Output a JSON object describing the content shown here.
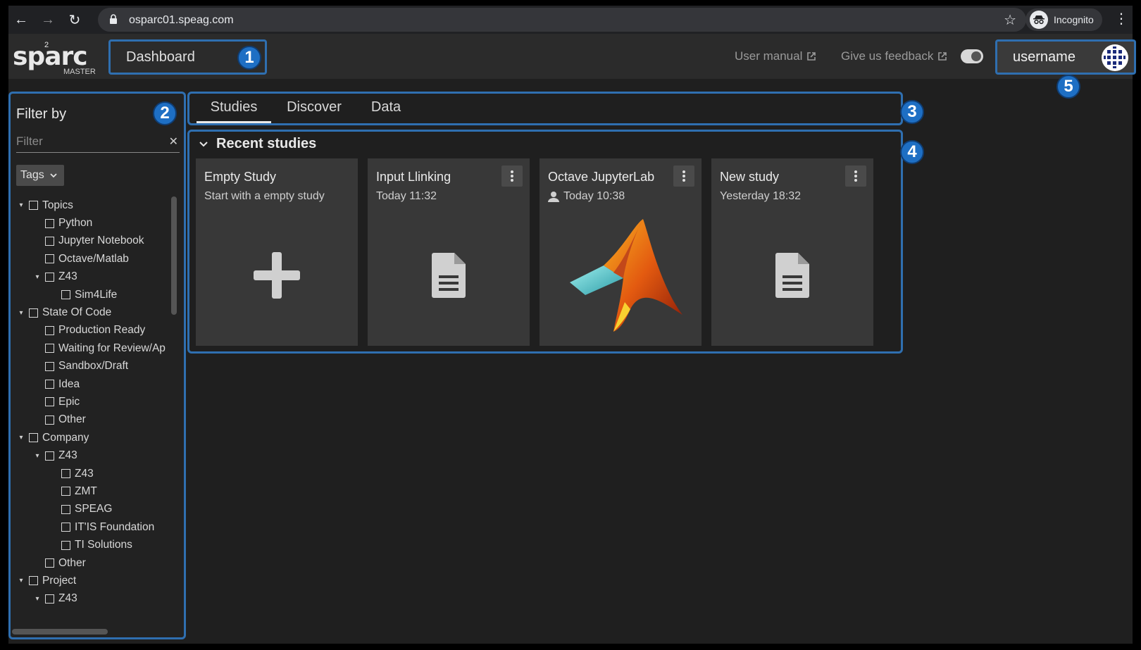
{
  "browser": {
    "url": "osparc01.speag.com",
    "profile_label": "Incognito"
  },
  "header": {
    "logo_text": "sparc",
    "logo_superscript": "2",
    "logo_subtitle": "MASTER",
    "dashboard_label": "Dashboard",
    "user_manual_label": "User manual",
    "feedback_label": "Give us feedback",
    "username": "username"
  },
  "badges": [
    "1",
    "2",
    "3",
    "4",
    "5"
  ],
  "filter": {
    "title": "Filter by",
    "placeholder": "Filter",
    "tags_label": "Tags",
    "tree": [
      {
        "label": "Topics",
        "level": 0,
        "expandable": true
      },
      {
        "label": "Python",
        "level": 1,
        "expandable": false
      },
      {
        "label": "Jupyter Notebook",
        "level": 1,
        "expandable": false
      },
      {
        "label": "Octave/Matlab",
        "level": 1,
        "expandable": false
      },
      {
        "label": "Z43",
        "level": 1,
        "expandable": true
      },
      {
        "label": "Sim4Life",
        "level": 2,
        "expandable": false
      },
      {
        "label": "State Of Code",
        "level": 0,
        "expandable": true
      },
      {
        "label": "Production Ready",
        "level": 1,
        "expandable": false
      },
      {
        "label": "Waiting for Review/Ap",
        "level": 1,
        "expandable": false
      },
      {
        "label": "Sandbox/Draft",
        "level": 1,
        "expandable": false
      },
      {
        "label": "Idea",
        "level": 1,
        "expandable": false
      },
      {
        "label": "Epic",
        "level": 1,
        "expandable": false
      },
      {
        "label": "Other",
        "level": 1,
        "expandable": false
      },
      {
        "label": "Company",
        "level": 0,
        "expandable": true
      },
      {
        "label": "Z43",
        "level": 1,
        "expandable": true
      },
      {
        "label": "Z43",
        "level": 2,
        "expandable": false
      },
      {
        "label": "ZMT",
        "level": 2,
        "expandable": false
      },
      {
        "label": "SPEAG",
        "level": 2,
        "expandable": false
      },
      {
        "label": "IT'IS Foundation",
        "level": 2,
        "expandable": false
      },
      {
        "label": "TI Solutions",
        "level": 2,
        "expandable": false
      },
      {
        "label": "Other",
        "level": 1,
        "expandable": false
      },
      {
        "label": "Project",
        "level": 0,
        "expandable": true
      },
      {
        "label": "Z43",
        "level": 1,
        "expandable": true
      }
    ]
  },
  "tabs": [
    {
      "label": "Studies",
      "active": true
    },
    {
      "label": "Discover",
      "active": false
    },
    {
      "label": "Data",
      "active": false
    }
  ],
  "recent_studies": {
    "title": "Recent studies",
    "cards": [
      {
        "title": "Empty Study",
        "subtitle": "Start with a empty study",
        "thumb": "plus-icon",
        "has_menu": false,
        "shared": false
      },
      {
        "title": "Input Llinking",
        "subtitle": "Today 11:32",
        "thumb": "document-icon",
        "has_menu": true,
        "shared": false
      },
      {
        "title": "Octave JupyterLab",
        "subtitle": "Today 10:38",
        "thumb": "matlab-logo-icon",
        "has_menu": true,
        "shared": true
      },
      {
        "title": "New study",
        "subtitle": "Yesterday 18:32",
        "thumb": "document-icon",
        "has_menu": true,
        "shared": false
      }
    ]
  },
  "colors": {
    "highlight_border": "#2f6fb0",
    "badge": "#1e6fc4",
    "app_bg": "#1f1f1f",
    "card_bg": "#383838"
  }
}
